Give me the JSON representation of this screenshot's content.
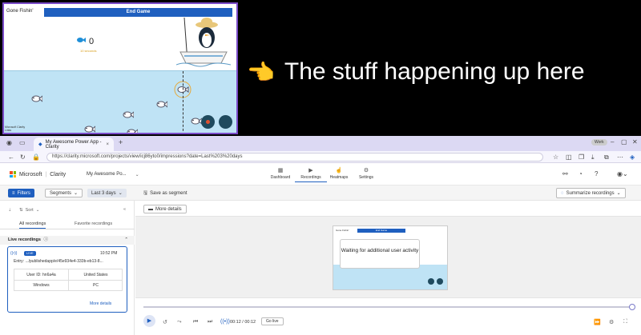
{
  "game": {
    "title": "Gone Fishin'",
    "end_button": "End Game",
    "fish_count": "0",
    "sub_label": "10 seconds",
    "brand": "Microsoft Clarity Links"
  },
  "caption": {
    "emoji": "👈",
    "text": "The stuff happening up here"
  },
  "browser": {
    "tab_title": "My Awesome Power App - Clarity",
    "tab_close": "×",
    "new_tab": "+",
    "url": "https://clarity.microsoft.com/projects/view/icj86yto0/impressions?date=Last%203%20days",
    "profile_label": "Work"
  },
  "app": {
    "brand": "Microsoft",
    "product": "Clarity",
    "project": "My Awesome Po...",
    "nav": [
      {
        "label": "Dashboard",
        "icon": "▦"
      },
      {
        "label": "Recordings",
        "icon": "▶"
      },
      {
        "label": "Heatmaps",
        "icon": "☝"
      },
      {
        "label": "Settings",
        "icon": "⚙"
      }
    ]
  },
  "toolbar": {
    "filters": "Filters",
    "segments": "Segments",
    "date": "Last 3 days",
    "save_segment": "Save as segment",
    "summarize": "Summarize recordings"
  },
  "side": {
    "sort": "Sort",
    "tab_all": "All recordings",
    "tab_fav": "Favorite recordings",
    "live_header": "Live recordings",
    "card": {
      "badge": "LIVE",
      "time": "10:52 PM",
      "entry": "Entry: .../publishedapp/e/45e934e4-333b-eb13-8...",
      "user": "User ID: hn6a4a",
      "country": "United States",
      "os": "Windows",
      "device": "PC",
      "more": "More details"
    }
  },
  "main": {
    "more_details": "More details",
    "waiting": "Waiting for additional user activity",
    "preview_title": "Gone Fishin'",
    "preview_end": "End Game",
    "time": "00:12 / 00:12",
    "go_live": "Go live"
  },
  "colors": {
    "accent": "#1f5fbf",
    "tabbar": "#dcd9f3",
    "water": "#bfe3f5"
  }
}
